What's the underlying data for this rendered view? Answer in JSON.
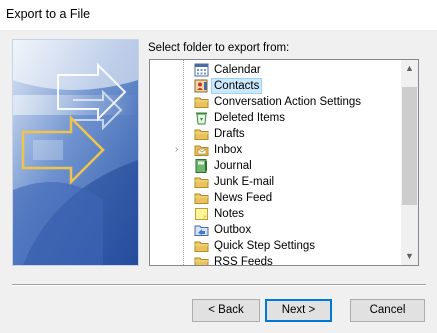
{
  "window": {
    "title": "Export to a File"
  },
  "prompt": {
    "text": "Select folder to export from:"
  },
  "folders": [
    {
      "label": "Calendar",
      "icon": "calendar-icon",
      "selected": false,
      "expandable": false
    },
    {
      "label": "Contacts",
      "icon": "contacts-icon",
      "selected": true,
      "expandable": false
    },
    {
      "label": "Conversation Action Settings",
      "icon": "folder-icon",
      "selected": false,
      "expandable": false
    },
    {
      "label": "Deleted Items",
      "icon": "recycle-bin-icon",
      "selected": false,
      "expandable": false
    },
    {
      "label": "Drafts",
      "icon": "folder-icon",
      "selected": false,
      "expandable": false
    },
    {
      "label": "Inbox",
      "icon": "inbox-folder-icon",
      "selected": false,
      "expandable": true
    },
    {
      "label": "Journal",
      "icon": "journal-icon",
      "selected": false,
      "expandable": false
    },
    {
      "label": "Junk E-mail",
      "icon": "folder-icon",
      "selected": false,
      "expandable": false
    },
    {
      "label": "News Feed",
      "icon": "folder-icon",
      "selected": false,
      "expandable": false
    },
    {
      "label": "Notes",
      "icon": "notes-icon",
      "selected": false,
      "expandable": false
    },
    {
      "label": "Outbox",
      "icon": "outbox-icon",
      "selected": false,
      "expandable": false
    },
    {
      "label": "Quick Step Settings",
      "icon": "folder-icon",
      "selected": false,
      "expandable": false
    },
    {
      "label": "RSS Feeds",
      "icon": "folder-icon",
      "selected": false,
      "expandable": false
    }
  ],
  "buttons": {
    "back": "< Back",
    "next": "Next >",
    "cancel": "Cancel"
  },
  "colors": {
    "selection": "#cce8ff",
    "folder": "#e8c35b",
    "accent": "#0078d7"
  }
}
